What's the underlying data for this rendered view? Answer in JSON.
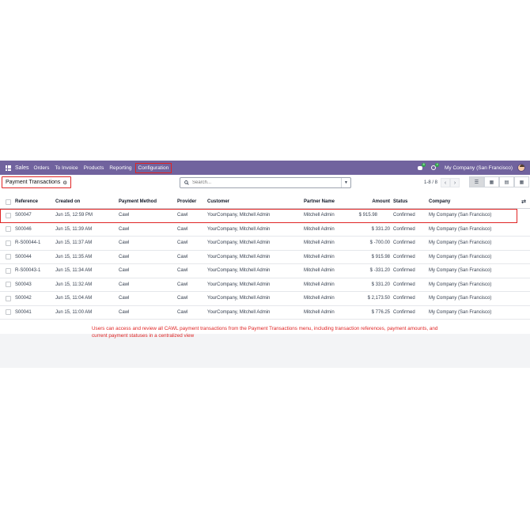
{
  "navbar": {
    "app_name": "Sales",
    "items": [
      "Orders",
      "To Invoice",
      "Products",
      "Reporting",
      "Configuration"
    ],
    "messages_badge": "8",
    "activities_badge": "4",
    "company": "My Company (San Francisco)"
  },
  "control": {
    "breadcrumb": "Payment Transactions",
    "search_placeholder": "Search...",
    "pager": "1-8 / 8"
  },
  "table": {
    "headers": {
      "reference": "Reference",
      "created_on": "Created on",
      "payment_method": "Payment Method",
      "provider": "Provider",
      "customer": "Customer",
      "partner_name": "Partner Name",
      "amount": "Amount",
      "status": "Status",
      "company": "Company"
    },
    "rows": [
      {
        "reference": "S00047",
        "created_on": "Jun 15, 12:59 PM",
        "payment_method": "Cawl",
        "provider": "Cawl",
        "customer": "YourCompany, Mitchell Admin",
        "partner_name": "Mitchell Admin",
        "amount": "$ 915.98",
        "status": "Confirmed",
        "company": "My Company (San Francisco)"
      },
      {
        "reference": "S00046",
        "created_on": "Jun 15, 11:39 AM",
        "payment_method": "Cawl",
        "provider": "Cawl",
        "customer": "YourCompany, Mitchell Admin",
        "partner_name": "Mitchell Admin",
        "amount": "$ 331.20",
        "status": "Confirmed",
        "company": "My Company (San Francisco)"
      },
      {
        "reference": "R-S00044-1",
        "created_on": "Jun 15, 11:37 AM",
        "payment_method": "Cawl",
        "provider": "Cawl",
        "customer": "YourCompany, Mitchell Admin",
        "partner_name": "Mitchell Admin",
        "amount": "$ -700.00",
        "status": "Confirmed",
        "company": "My Company (San Francisco)"
      },
      {
        "reference": "S00044",
        "created_on": "Jun 15, 11:35 AM",
        "payment_method": "Cawl",
        "provider": "Cawl",
        "customer": "YourCompany, Mitchell Admin",
        "partner_name": "Mitchell Admin",
        "amount": "$ 915.98",
        "status": "Confirmed",
        "company": "My Company (San Francisco)"
      },
      {
        "reference": "R-S00043-1",
        "created_on": "Jun 15, 11:34 AM",
        "payment_method": "Cawl",
        "provider": "Cawl",
        "customer": "YourCompany, Mitchell Admin",
        "partner_name": "Mitchell Admin",
        "amount": "$ -331.20",
        "status": "Confirmed",
        "company": "My Company (San Francisco)"
      },
      {
        "reference": "S00043",
        "created_on": "Jun 15, 11:32 AM",
        "payment_method": "Cawl",
        "provider": "Cawl",
        "customer": "YourCompany, Mitchell Admin",
        "partner_name": "Mitchell Admin",
        "amount": "$ 331.20",
        "status": "Confirmed",
        "company": "My Company (San Francisco)"
      },
      {
        "reference": "S00042",
        "created_on": "Jun 15, 11:04 AM",
        "payment_method": "Cawl",
        "provider": "Cawl",
        "customer": "YourCompany, Mitchell Admin",
        "partner_name": "Mitchell Admin",
        "amount": "$ 2,173.50",
        "status": "Confirmed",
        "company": "My Company (San Francisco)"
      },
      {
        "reference": "S00041",
        "created_on": "Jun 15, 11:00 AM",
        "payment_method": "Cawl",
        "provider": "Cawl",
        "customer": "YourCompany, Mitchell Admin",
        "partner_name": "Mitchell Admin",
        "amount": "$ 776.25",
        "status": "Confirmed",
        "company": "My Company (San Francisco)"
      }
    ]
  },
  "caption": "Users can access and review all CAWL payment transactions from the Payment Transactions menu, including transaction references, payment amounts, and current payment statuses in a centralized view",
  "colors": {
    "navbar": "#71639e",
    "highlight": "#e02424",
    "badge": "#28a745"
  }
}
